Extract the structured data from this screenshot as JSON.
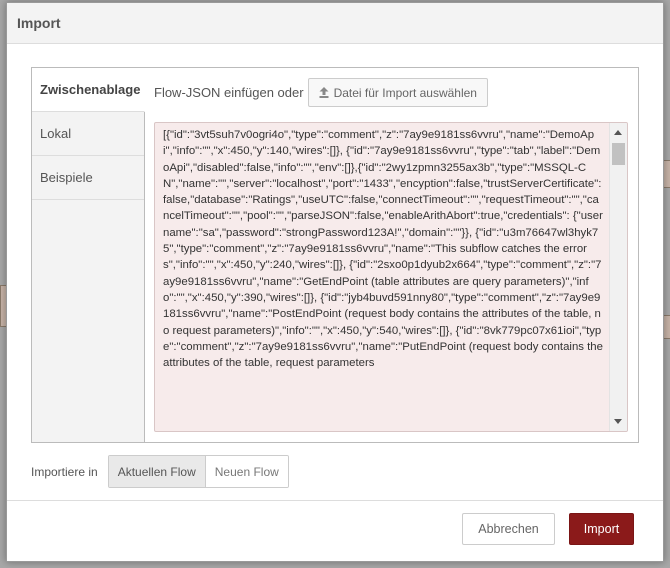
{
  "dialog": {
    "title": "Import"
  },
  "tabs": [
    {
      "label": "Zwischenablage"
    },
    {
      "label": "Lokal"
    },
    {
      "label": "Beispiele"
    }
  ],
  "clipboard": {
    "paste_label": "Flow-JSON einfügen oder",
    "file_button_label": "Datei für Import auswählen",
    "json_text": "[{\"id\":\"3vt5suh7v0ogri4o\",\"type\":\"comment\",\"z\":\"7ay9e9181ss6vvru\",\"name\":\"DemoApi\",\"info\":\"\",\"x\":450,\"y\":140,\"wires\":[]}, {\"id\":\"7ay9e9181ss6vvru\",\"type\":\"tab\",\"label\":\"DemoApi\",\"disabled\":false,\"info\":\"\",\"env\":[]},{\"id\":\"2wy1zpmn3255ax3b\",\"type\":\"MSSQL-CN\",\"name\":\"\",\"server\":\"localhost\",\"port\":\"1433\",\"encyption\":false,\"trustServerCertificate\":false,\"database\":\"Ratings\",\"useUTC\":false,\"connectTimeout\":\"\",\"requestTimeout\":\"\",\"cancelTimeout\":\"\",\"pool\":\"\",\"parseJSON\":false,\"enableArithAbort\":true,\"credentials\": {\"username\":\"sa\",\"password\":\"strongPassword123A!\",\"domain\":\"\"}}, {\"id\":\"u3m76647wl3hyk75\",\"type\":\"comment\",\"z\":\"7ay9e9181ss6vvru\",\"name\":\"This subflow catches the errors\",\"info\":\"\",\"x\":450,\"y\":240,\"wires\":[]}, {\"id\":\"2sxo0p1dyub2x664\",\"type\":\"comment\",\"z\":\"7ay9e9181ss6vvru\",\"name\":\"GetEndPoint (table attributes are query parameters)\",\"info\":\"\",\"x\":450,\"y\":390,\"wires\":[]}, {\"id\":\"jyb4buvd591nny80\",\"type\":\"comment\",\"z\":\"7ay9e9181ss6vvru\",\"name\":\"PostEndPoint (request body contains the attributes of the table, no request parameters)\",\"info\":\"\",\"x\":450,\"y\":540,\"wires\":[]}, {\"id\":\"8vk779pc07x61ioi\",\"type\":\"comment\",\"z\":\"7ay9e9181ss6vvru\",\"name\":\"PutEndPoint (request body contains the attributes of the table, request parameters"
  },
  "import_target": {
    "label": "Importiere in",
    "options": [
      "Aktuellen Flow",
      "Neuen Flow"
    ],
    "selected": "Aktuellen Flow"
  },
  "footer": {
    "cancel_label": "Abbrechen",
    "import_label": "Import"
  },
  "colors": {
    "primary": "#8b1a1a",
    "json_background": "#f7ebeb"
  }
}
